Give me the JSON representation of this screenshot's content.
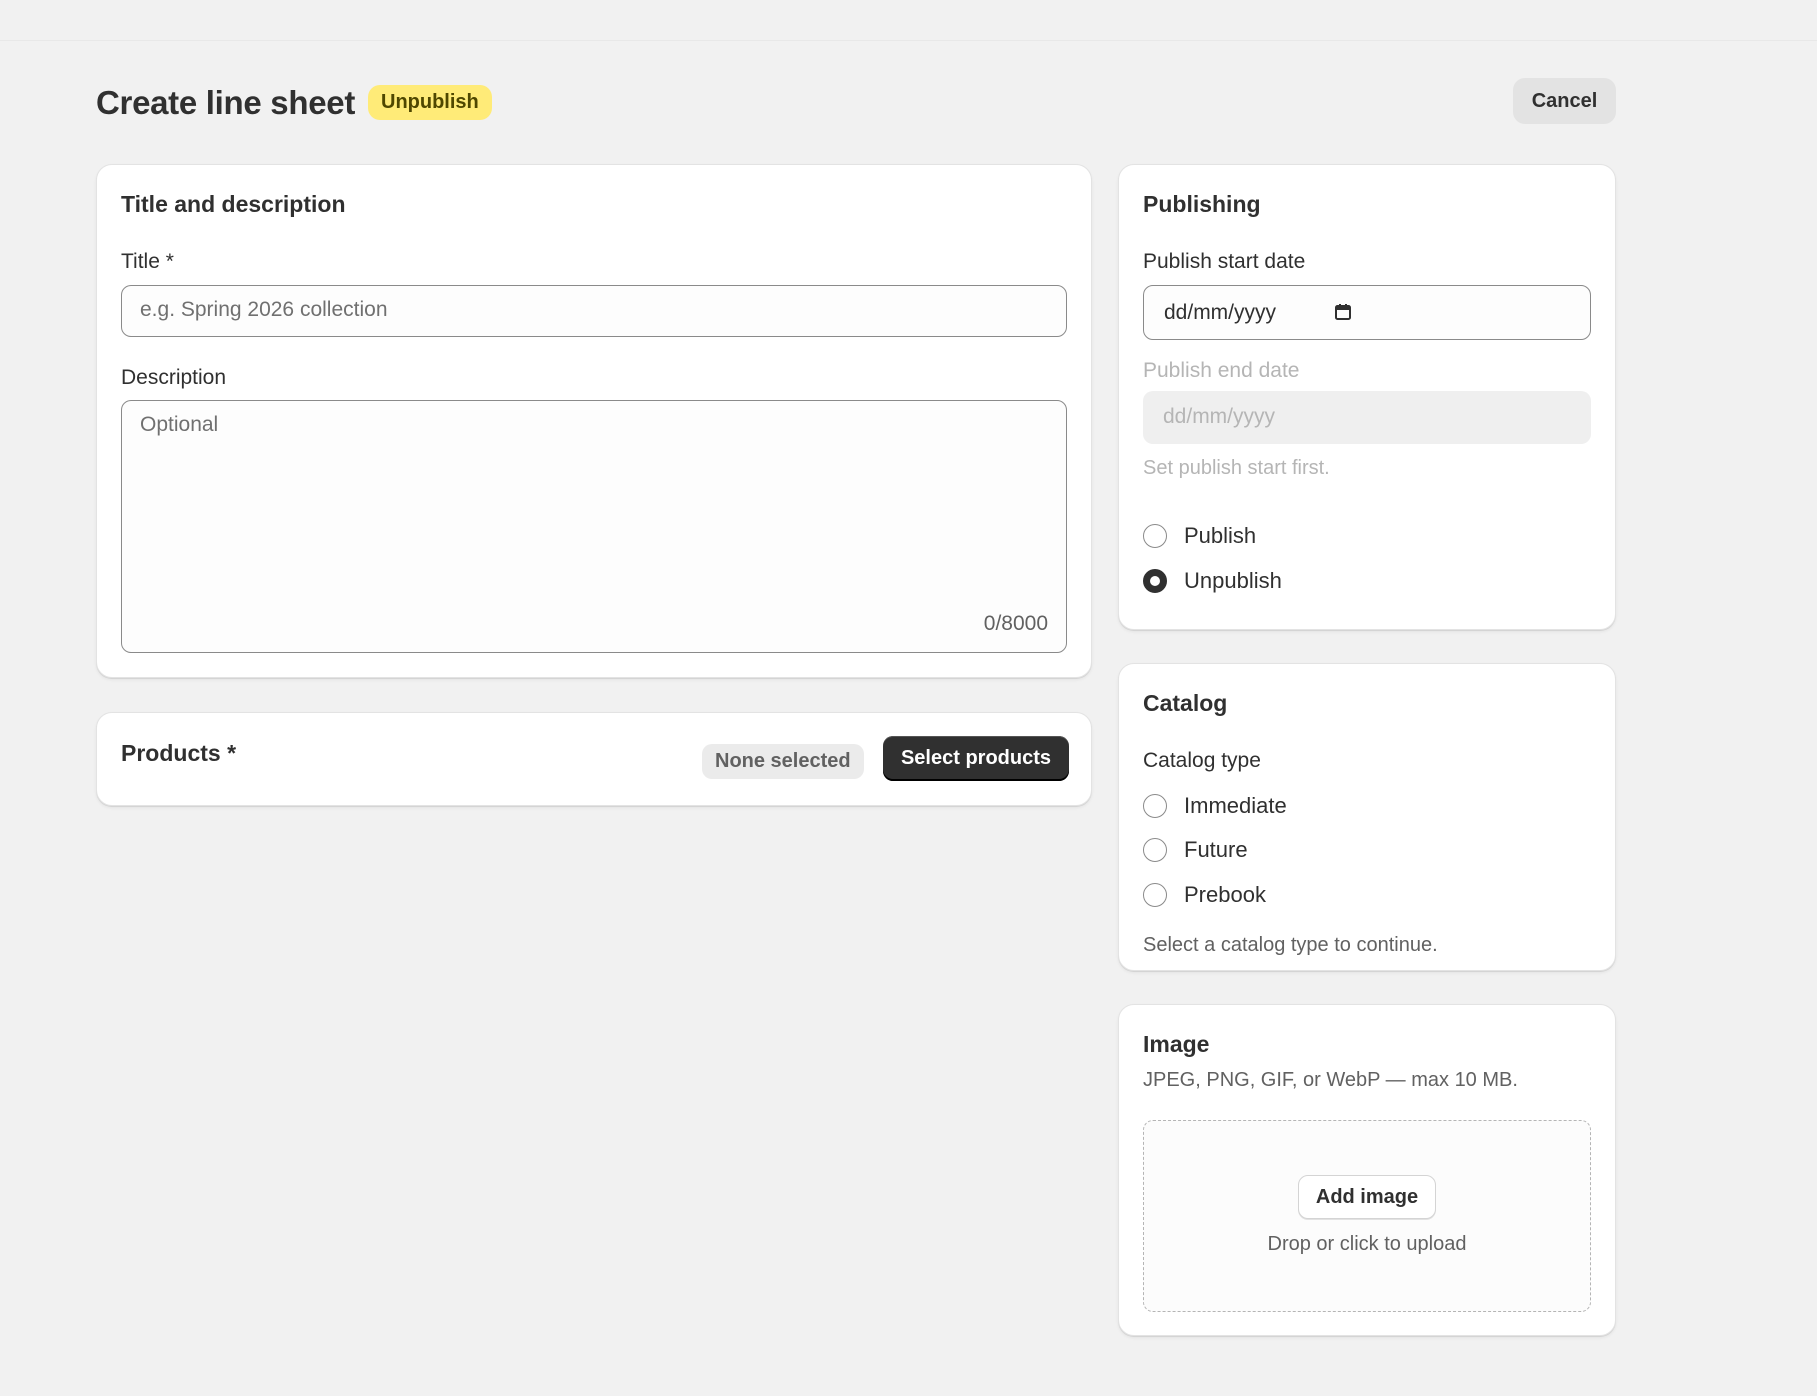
{
  "header": {
    "title": "Create line sheet",
    "status_badge": "Unpublish",
    "cancel_label": "Cancel"
  },
  "title_card": {
    "heading": "Title and description",
    "title_label": "Title *",
    "title_placeholder": "e.g. Spring 2026 collection",
    "description_label": "Description",
    "description_placeholder": "Optional",
    "char_count": "0/8000"
  },
  "products_card": {
    "heading": "Products *",
    "selection_status": "None selected",
    "select_button": "Select products"
  },
  "publishing_card": {
    "heading": "Publishing",
    "start_label": "Publish start date",
    "start_value": "dd/mm/yyyy",
    "end_label": "Publish end date",
    "end_value": "dd/mm/yyyy",
    "end_help": "Set publish start first.",
    "options": [
      {
        "label": "Publish",
        "checked": false
      },
      {
        "label": "Unpublish",
        "checked": true
      }
    ]
  },
  "catalog_card": {
    "heading": "Catalog",
    "type_label": "Catalog type",
    "options": [
      {
        "label": "Immediate",
        "checked": false
      },
      {
        "label": "Future",
        "checked": false
      },
      {
        "label": "Prebook",
        "checked": false
      }
    ],
    "help": "Select a catalog type to continue."
  },
  "image_card": {
    "heading": "Image",
    "subtitle": "JPEG, PNG, GIF, or WebP — max 10 MB.",
    "add_button": "Add image",
    "drop_hint": "Drop or click to upload"
  },
  "colors": {
    "badge_bg": "#ffeb78",
    "primary_button": "#303030",
    "page_bg": "#f1f1f1"
  },
  "icons": {
    "calendar": "calendar-icon"
  }
}
